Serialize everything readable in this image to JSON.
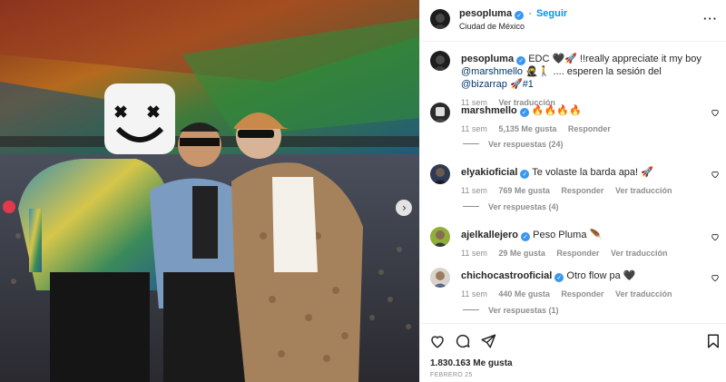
{
  "post": {
    "username": "pesopluma",
    "follow_label": "Seguir",
    "location": "Ciudad de México",
    "caption_prefix": "EDC ",
    "caption_mid": " !!really appreciate it my boy",
    "caption_mention1": "@marshmello",
    "caption_mid2": " .... esperen la sesión del ",
    "caption_mention2": "@bizarrap",
    "caption_suffix": "#1",
    "caption_time": "11 sem",
    "caption_translate": "Ver traducción"
  },
  "comments": [
    {
      "username": "marshmello",
      "text": "🔥🔥🔥🔥",
      "time": "11 sem",
      "likes": "5,135 Me gusta",
      "reply": "Responder",
      "translate": "",
      "replies": "Ver respuestas (24)"
    },
    {
      "username": "elyakioficial",
      "text": "Te volaste la barda apa! 🚀",
      "time": "11 sem",
      "likes": "769 Me gusta",
      "reply": "Responder",
      "translate": "Ver traducción",
      "replies": "Ver respuestas (4)"
    },
    {
      "username": "ajelkallejero",
      "text": "Peso Pluma 🪶",
      "time": "11 sem",
      "likes": "29 Me gusta",
      "reply": "Responder",
      "translate": "Ver traducción",
      "replies": ""
    },
    {
      "username": "chichocastrooficial",
      "text": "Otro flow pa 🖤",
      "time": "11 sem",
      "likes": "440 Me gusta",
      "reply": "Responder",
      "translate": "Ver traducción",
      "replies": "Ver respuestas (1)"
    }
  ],
  "footer": {
    "likes": "1.830.163 Me gusta",
    "date": "FEBRERO 25"
  },
  "icons": {
    "more": "more-options-icon",
    "like": "heart-icon",
    "comment": "comment-icon",
    "share": "share-icon",
    "save": "bookmark-icon",
    "next": "chevron-right-icon"
  },
  "colors": {
    "link": "#0095f6",
    "mention": "#00376b",
    "verified": "#3897f0",
    "muted": "#8e8e8e"
  }
}
